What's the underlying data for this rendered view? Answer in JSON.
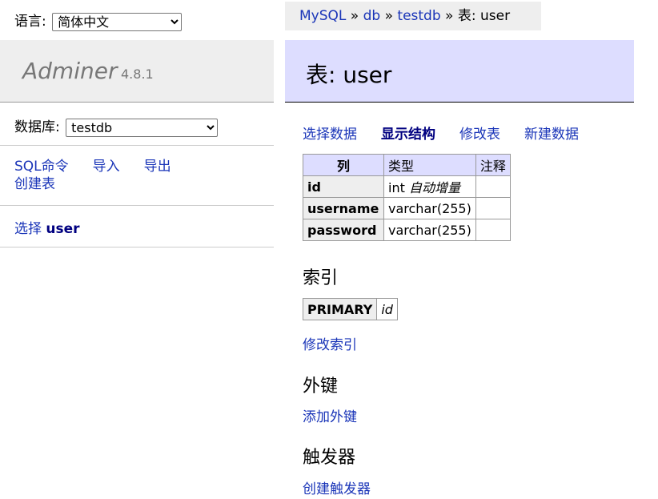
{
  "language": {
    "label": "语言:",
    "selected": "简体中文"
  },
  "logo": {
    "name": "Adminer",
    "version": "4.8.1"
  },
  "database": {
    "label": "数据库:",
    "selected": "testdb"
  },
  "left_links": {
    "sql": "SQL命令",
    "import": "导入",
    "export": "导出",
    "create_table": "创建表"
  },
  "left_table": {
    "select_label": "选择",
    "table_name": "user"
  },
  "breadcrumb": {
    "server": "MySQL",
    "sep": " » ",
    "db": "db",
    "database": "testdb",
    "current": "表: user"
  },
  "page_title": "表: user",
  "tabs": {
    "select_data": "选择数据",
    "show_structure": "显示结构",
    "alter_table": "修改表",
    "new_item": "新建数据"
  },
  "columns_table": {
    "headers": [
      "列",
      "类型",
      "注释"
    ],
    "rows": [
      {
        "name": "id",
        "type": "int",
        "extra": "自动增量",
        "comment": ""
      },
      {
        "name": "username",
        "type": "varchar(255)",
        "extra": "",
        "comment": ""
      },
      {
        "name": "password",
        "type": "varchar(255)",
        "extra": "",
        "comment": ""
      }
    ]
  },
  "indexes": {
    "title": "索引",
    "type": "PRIMARY",
    "columns": "id",
    "alter_link": "修改索引"
  },
  "foreign_keys": {
    "title": "外键",
    "add_link": "添加外键"
  },
  "triggers": {
    "title": "触发器",
    "create_link": "创建触发器"
  }
}
